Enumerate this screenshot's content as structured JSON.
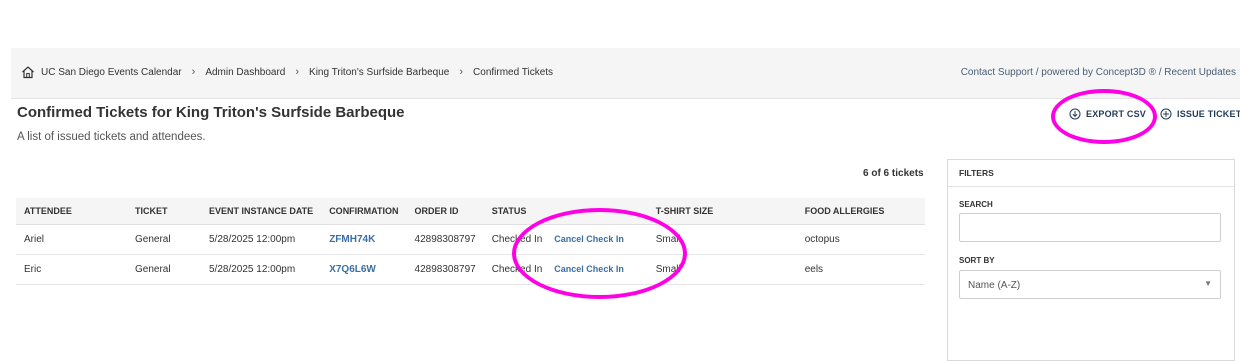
{
  "breadcrumb": {
    "items": [
      "UC San Diego Events Calendar",
      "Admin Dashboard",
      "King Triton's Surfside Barbeque",
      "Confirmed Tickets"
    ],
    "separator": "›"
  },
  "support_text": "Contact Support / powered by Concept3D ® / Recent Updates",
  "page": {
    "title": "Confirmed Tickets for King Triton's Surfside Barbeque",
    "subtitle": "A list of issued tickets and attendees."
  },
  "actions": {
    "export_label": "EXPORT CSV",
    "issue_label": "ISSUE TICKET"
  },
  "ticket_count": "6 of 6 tickets",
  "table": {
    "headers": [
      "ATTENDEE",
      "TICKET",
      "EVENT INSTANCE DATE",
      "CONFIRMATION",
      "ORDER ID",
      "STATUS",
      "T-SHIRT SIZE",
      "FOOD ALLERGIES"
    ],
    "rows": [
      {
        "attendee": "Ariel",
        "ticket": "General",
        "date": "5/28/2025 12:00pm",
        "confirmation": "ZFMH74K",
        "order_id": "42898308797",
        "status": "Checked In",
        "action": "Cancel Check In",
        "tshirt": "Small",
        "allergies": "octopus"
      },
      {
        "attendee": "Eric",
        "ticket": "General",
        "date": "5/28/2025 12:00pm",
        "confirmation": "X7Q6L6W",
        "order_id": "42898308797",
        "status": "Checked In",
        "action": "Cancel Check In",
        "tshirt": "Small",
        "allergies": "eels"
      }
    ]
  },
  "filters": {
    "title": "FILTERS",
    "search_label": "SEARCH",
    "search_value": "",
    "sort_label": "SORT BY",
    "sort_value": "Name (A-Z)"
  },
  "colors": {
    "annotation": "#ff00e6",
    "link": "#3a6fa6",
    "header_button": "#1f3b5b"
  }
}
